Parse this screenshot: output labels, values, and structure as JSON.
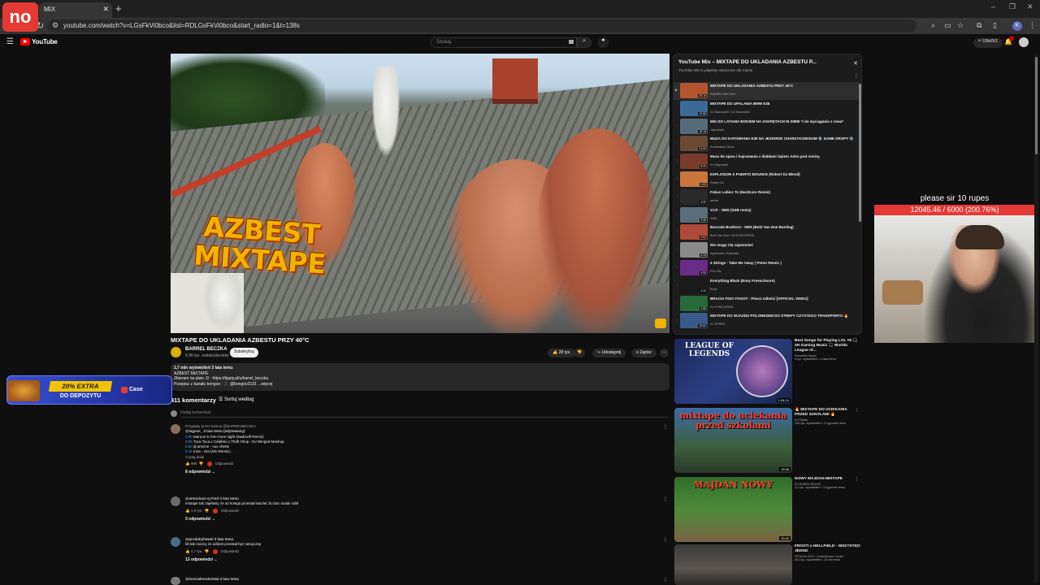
{
  "browser": {
    "brand_logo": "no",
    "tab_title": "MIX",
    "tab_close": "✕",
    "new_tab": "+",
    "url": "youtube.com/watch?v=LGsFkVi0bco&list=RDLGsFkVi0bco&start_radio=1&t=138s",
    "profile_initial": "K",
    "window_controls": [
      "–",
      "❐",
      "✕"
    ]
  },
  "youtube": {
    "logo_text": "YouTube",
    "logo_suffix": "PL",
    "search_placeholder": "Szukaj",
    "create_label": "+ Utwórz"
  },
  "video": {
    "title": "MIXTAPE DO UKLADANIA AZBESTU PRZY 40°C",
    "thumbnail_text": "AZBEST MIXTAPE",
    "channel_name": "BARREL BECZKA",
    "channel_subs": "6,96 tys. subskrybentów",
    "subscribe_label": "Subskrybuj",
    "likes": "28 tys.",
    "share_label": "Udostępnij",
    "save_label": "Zapisz",
    "description": {
      "stats": "2,7 mln wyświetleń  3 lata temu",
      "line1": "AZBEST MIXTAPE",
      "line2": "Zbieram na piwo :D : https://tipply.pl/u/barrel_beczka",
      "line3": "Przepisz z kanału bongoo : 🎵 @bongoo3131 ...więcej"
    }
  },
  "comments": {
    "count": "411 komentarzy",
    "sort_label": "Sortuj według",
    "add_placeholder": "Dodaj komentarz",
    "items": [
      {
        "pinned": "Przypięty przez twórcę @BARRELBECZKA",
        "author": "@tagsss_  3 lata temu (edytowany)",
        "lines": [
          {
            "ts": "0:00",
            "text": " Maroon 5 One more night (Sadrooff Remix)"
          },
          {
            "ts": "3:05",
            "text": " Toca Toca x Celebrio x Thrift Shop - DJ Winged Mashup"
          },
          {
            "ts": "5:50",
            "text": " dj amcine - nox cherie"
          },
          {
            "ts": "8:15",
            "text": " Inna - Hot (NG Remix)..."
          }
        ],
        "more": "Czytaj dalej",
        "likes": "988",
        "reply_label": "Odpowiedz",
        "replies": "8 odpowiedzi"
      },
      {
        "author": "@antoniusz-sy7md  3 lata temu",
        "text": "mixtape tak zajebisty że aż kolega przestał kaszleć bo bez maski robił",
        "likes": "1,9 tys.",
        "reply_label": "Odpowiedz",
        "replies": "3 odpowiedzi"
      },
      {
        "author": "@produkyhawel  3 lata temu",
        "text": "bit tak mocny że azbest przestał być toksyczny",
        "likes": "4,7 tys.",
        "reply_label": "Odpowiedz",
        "replies": "13 odpowiedzi"
      },
      {
        "author": "@konradmods3164  3 lata temu"
      }
    ]
  },
  "playlist": {
    "title": "YouTube Mix – MIXTAPE DO UKLADANIA AZBESTU P...",
    "subtitle": "YouTube Mix to playlisty stworzone dla Ciebie",
    "items": [
      {
        "title": "MIXTAPE DO UKLADANIA AZBESTU PRZY 40°C",
        "channel": "BARREL BECZKA",
        "duration": "26:19",
        "thumb": "#b2552f",
        "active": true
      },
      {
        "title": "MIXTAPE DO UPALANIA BMW E36",
        "channel": "DJ Mazzarelli / DJ Mazzarelli",
        "duration": "12:56",
        "thumb": "#3c6a94"
      },
      {
        "title": "MIX DO LATANIA BOKIEM NA ZAKRĘTACH W ZIMIE *i do wyciągania z rowu*",
        "channel": "Jaboolyd1",
        "duration": "18:18",
        "thumb": "#556b7a"
      },
      {
        "title": "MUZA DO KATOWANIA E39 NA JEZIORZE CHARZYKOWSKIM ❄️ DAME DROPY ❄️",
        "channel": "Przebranka Team",
        "duration": "31:09",
        "thumb": "#6b4a34"
      },
      {
        "title": "Muza do sjana i hajcowania z diabłami Opiem Astra pod remizą",
        "channel": "DJ Wapowiki",
        "duration": "8:25",
        "thumb": "#7a3a2c"
      },
      {
        "title": "EXPLOSION X PUERTO BOUNCE (Robert DJ Blend)",
        "channel": "Robert DJ",
        "duration": "2:53",
        "thumb": "#c9763a"
      },
      {
        "title": "Fokus Lubicz To (Hardcore Remix)",
        "channel": "nerda",
        "duration": "4:20",
        "thumb": "#2a2a2a"
      },
      {
        "title": "V.I.P. - SMS (SXB remix)",
        "channel": "SXB",
        "duration": "3:45",
        "thumb": "#5a6e7a"
      },
      {
        "title": "Barcode Brothers - SMS (BolZ Van Dee Bootleg)",
        "channel": "BolZ Van Dee / BVS RECORDS",
        "duration": "3:02",
        "thumb": "#b04a3a"
      },
      {
        "title": "Nie mogę Cię zapomnieć",
        "channel": "Agnieszka Chylińska",
        "duration": "4:13",
        "thumb": "#8a8a8a"
      },
      {
        "title": "4 Strings - Take Me Away ( Poton Remix )",
        "channel": "POLON",
        "duration": "4:33",
        "thumb": "#6a2a8a"
      },
      {
        "title": "Everything Black (Envy Freeschoore)",
        "channel": "Envy",
        "duration": "4:12",
        "thumb": "#1a1a1a"
      },
      {
        "title": "BRACIA FIGO FAGOT - Piesrz miłości [OFFICIAL VIDEO]",
        "channel": "DJ P RECORDS",
        "duration": "3:58",
        "thumb": "#2a6a3a"
      },
      {
        "title": "MIXTAPE DO WJAZDU POLONEZEM DO STREFY CZYSTEGO TRANSPORTU 🔥",
        "channel": "DJ SPREX",
        "duration": "19:02",
        "thumb": "#3a5a8a"
      }
    ]
  },
  "recommendations": [
    {
      "title": "Best Songs for Playing LOL #6 🎧 3H Gaming Music 🎧 Worlds League of...",
      "channel": "Smoothie Music",
      "meta": "6 tys. wyświetleń • 4 lata temu",
      "duration": "1:04:24",
      "thumb_text": "LEAGUE OF LEGENDS"
    },
    {
      "title": "🔥 MIXTAPE DO UCIEKANIA PRZED SZKOLAMI 🔥",
      "channel": "DJ Fakdu",
      "meta": "195 tys. wyświetleń • 3 tygodnie temu",
      "duration": "16:58",
      "thumb_text": "mixtape do uciekania przed szkolami"
    },
    {
      "title": "NOWY MAJDAN MIXTAPE",
      "channel": "DJ KUBEK BOLEK",
      "meta": "4,2 tys. wyświetleń • 3 tygodnie temu",
      "duration": "10:42",
      "thumb_text": "MAJDAN NOWY"
    },
    {
      "title": "FROSTI x HELLFIELD - WSZYSTKO JEDNO",
      "channel": "SPOLKA ZOO / CrashHouse Cartel",
      "meta": "502 tys. wyświetleń • 10 dni temu",
      "duration": "",
      "thumb_text": ""
    }
  ],
  "promo": {
    "extra": "20% EXTRA",
    "subtitle": "DO DEPOZYTU",
    "brand": "Case"
  },
  "stream": {
    "goal_text": "please sir 10 rupes",
    "goal_progress": "12045.46 / 6000 (200.76%)"
  }
}
